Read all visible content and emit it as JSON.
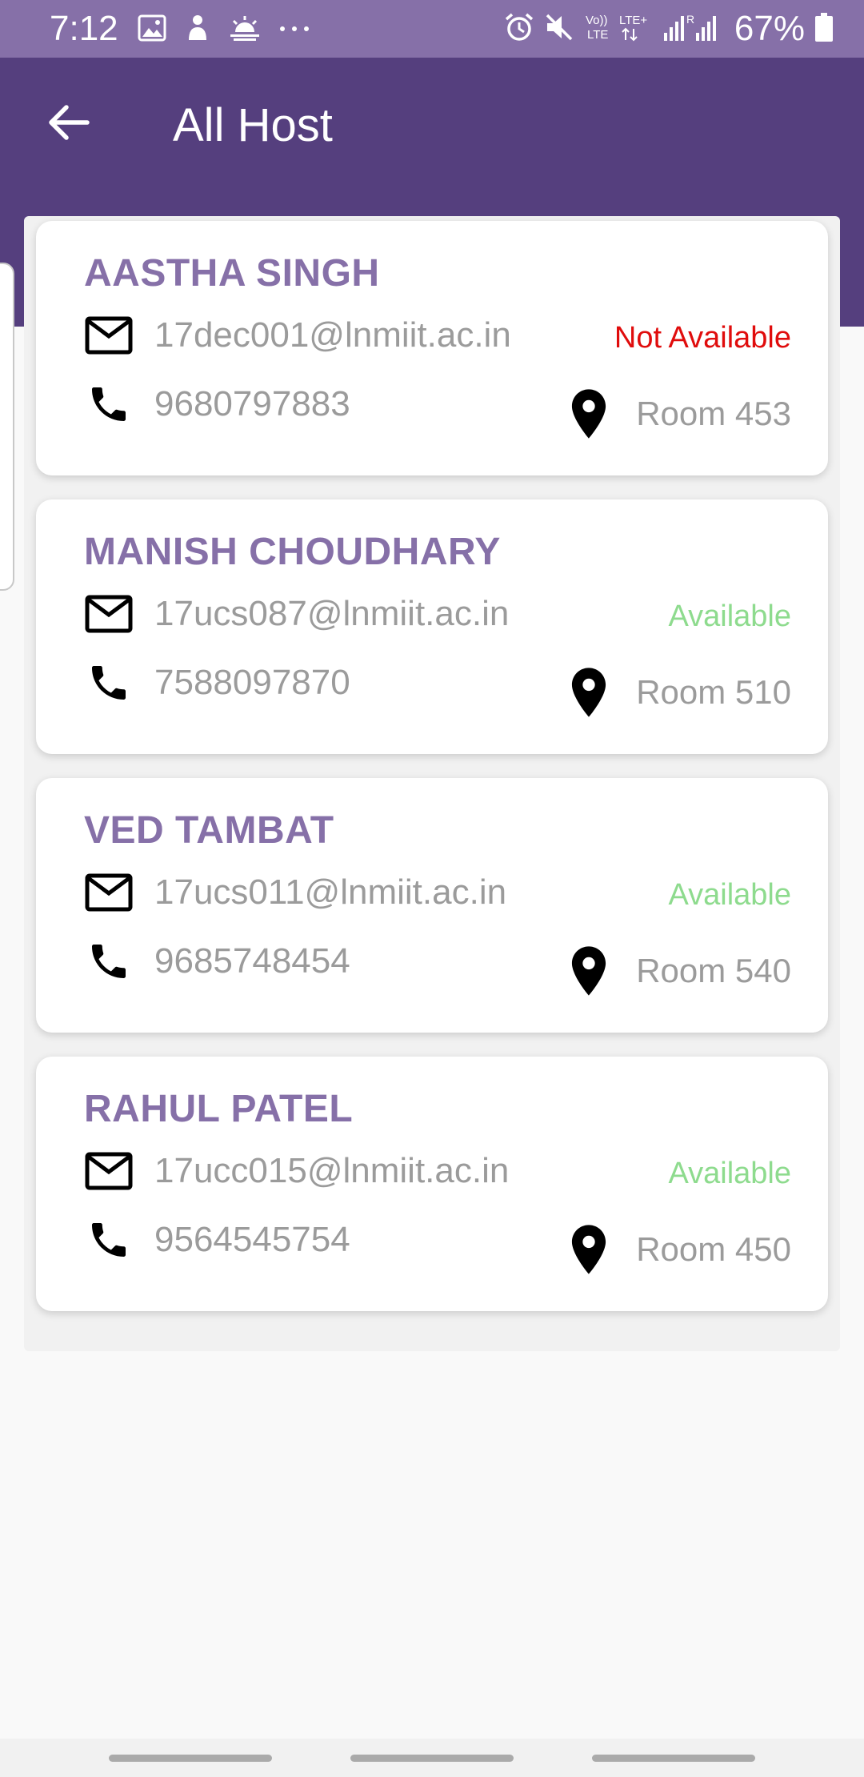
{
  "status_bar": {
    "time": "7:12",
    "battery": "67%",
    "left_icons": [
      "image-icon",
      "notification-icon",
      "weather-icon",
      "more-icon"
    ],
    "right_icons": [
      "alarm-icon",
      "mute-icon",
      "volte-icon",
      "signal-icon",
      "battery-icon"
    ]
  },
  "app_bar": {
    "title": "All Host"
  },
  "colors": {
    "header": "#553f7e",
    "status_bar": "#8670a8",
    "name": "#8670a8",
    "not_available": "#e00c0c",
    "available": "#8edb8e"
  },
  "hosts": [
    {
      "name": "AASTHA SINGH",
      "email": "17dec001@lnmiit.ac.in",
      "phone": "9680797883",
      "status": "Not Available",
      "room": "Room 453"
    },
    {
      "name": "MANISH CHOUDHARY",
      "email": "17ucs087@lnmiit.ac.in",
      "phone": "7588097870",
      "status": "Available",
      "room": "Room 510"
    },
    {
      "name": "VED TAMBAT",
      "email": "17ucs011@lnmiit.ac.in",
      "phone": "9685748454",
      "status": "Available",
      "room": "Room 540"
    },
    {
      "name": "RAHUL PATEL",
      "email": "17ucc015@lnmiit.ac.in",
      "phone": "9564545754",
      "status": "Available",
      "room": "Room 450"
    }
  ]
}
